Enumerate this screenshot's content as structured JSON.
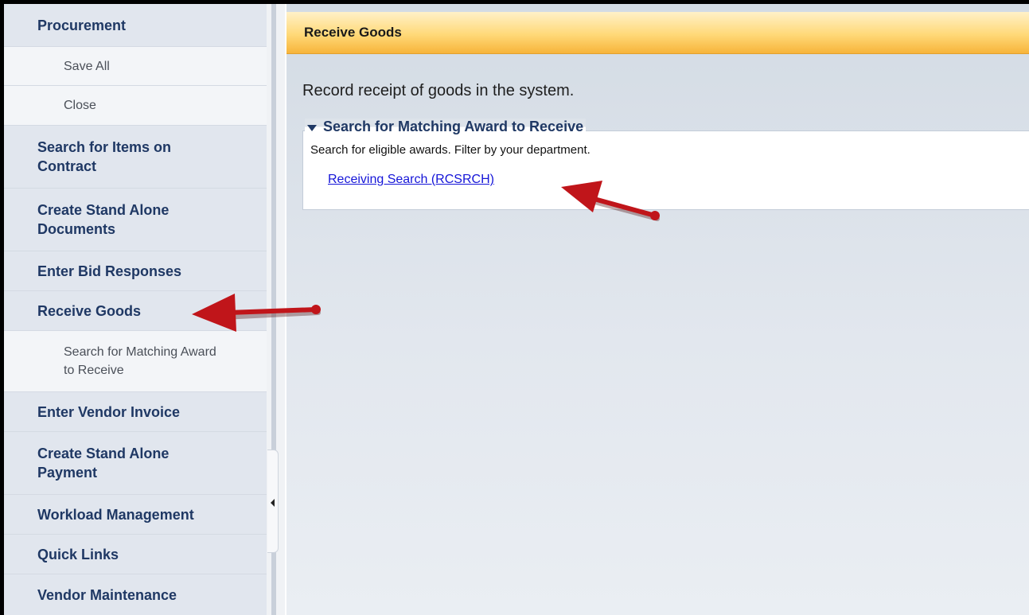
{
  "sidebar": {
    "items": [
      {
        "label": "Procurement",
        "kind": "main"
      },
      {
        "label": "Save All",
        "kind": "sub"
      },
      {
        "label": "Close",
        "kind": "sub"
      },
      {
        "label": "Search for Items on Contract",
        "kind": "main"
      },
      {
        "label": "Create Stand Alone Documents",
        "kind": "main"
      },
      {
        "label": "Enter Bid Responses",
        "kind": "main"
      },
      {
        "label": "Receive Goods",
        "kind": "main"
      },
      {
        "label": "Search for Matching Award to Receive",
        "kind": "sub"
      },
      {
        "label": "Enter Vendor Invoice",
        "kind": "main"
      },
      {
        "label": "Create Stand Alone Payment",
        "kind": "main"
      },
      {
        "label": "Workload Management",
        "kind": "main"
      },
      {
        "label": "Quick Links",
        "kind": "main"
      },
      {
        "label": "Vendor Maintenance",
        "kind": "main"
      }
    ]
  },
  "splitter": {
    "collapse_icon": "triangle-left-icon"
  },
  "main": {
    "header_title": "Receive Goods",
    "description": "Record receipt of goods in the system.",
    "section": {
      "legend": "Search for Matching Award to Receive",
      "legend_icon": "triangle-down-icon",
      "description": "Search for eligible awards. Filter by your department.",
      "link_label": "Receiving Search (RCSRCH)"
    }
  },
  "annotations": {
    "arrow_color": "#c0151a"
  }
}
